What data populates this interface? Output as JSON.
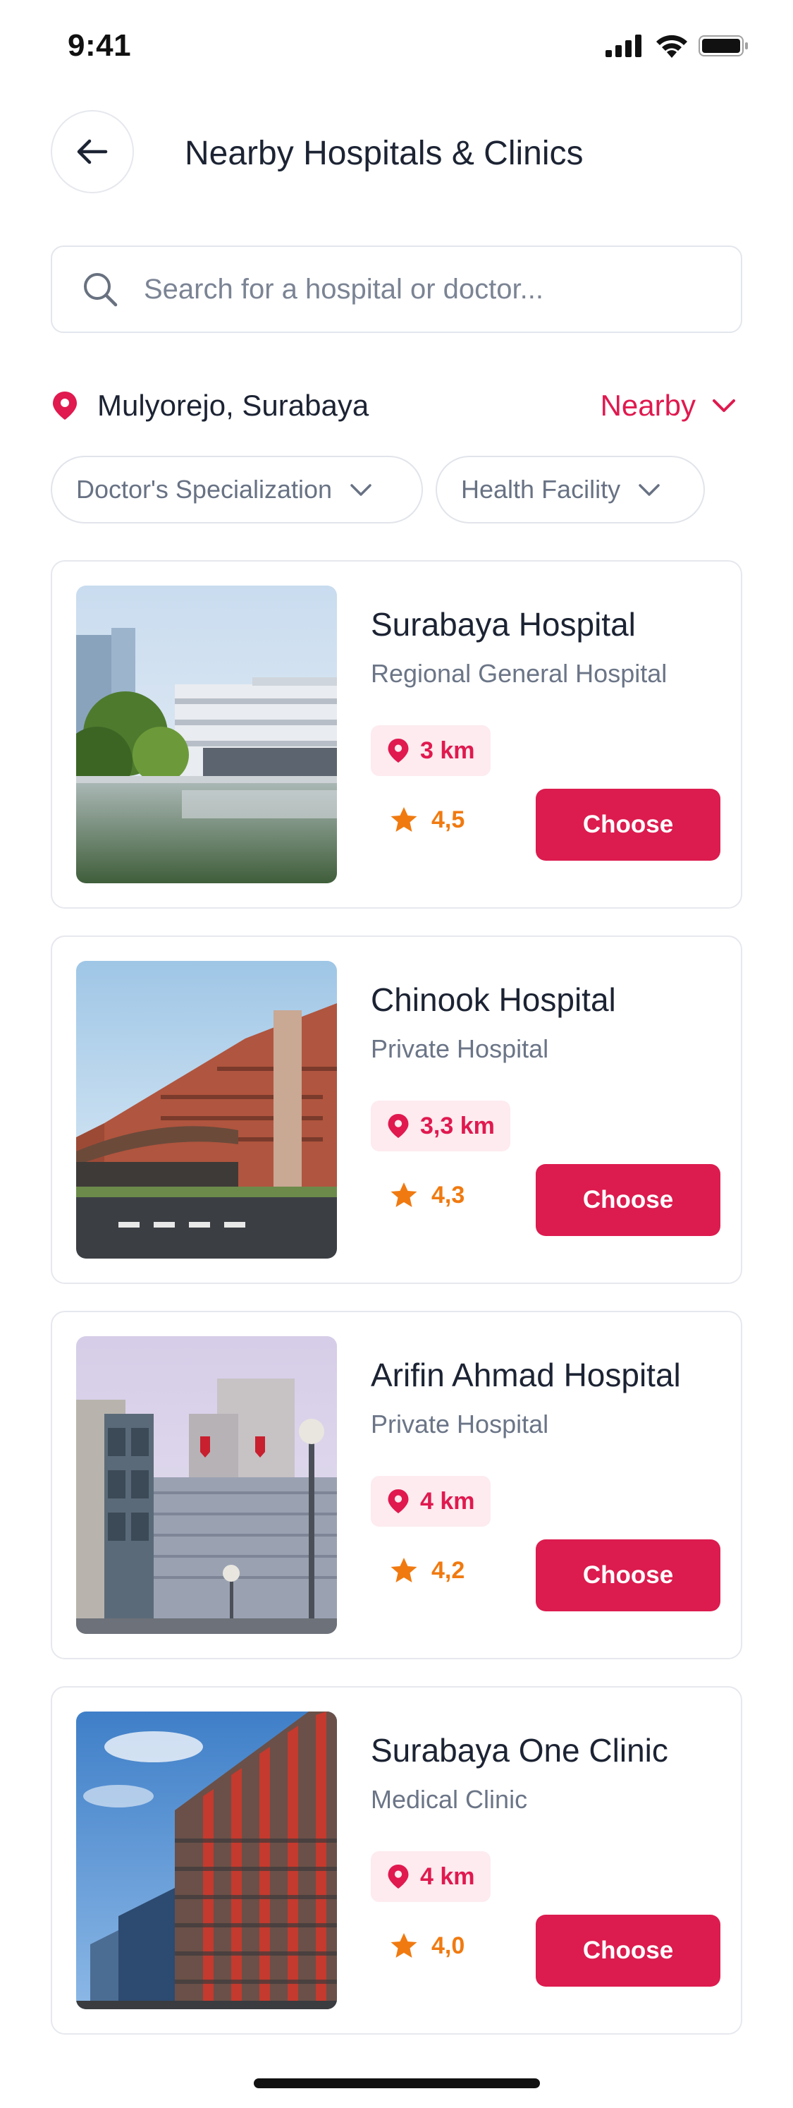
{
  "status_bar": {
    "time": "9:41"
  },
  "header": {
    "title": "Nearby Hospitals & Clinics",
    "back_icon": "arrow-left-icon"
  },
  "search": {
    "placeholder": "Search for a hospital or doctor...",
    "value": ""
  },
  "location": {
    "text": "Mulyorejo, Surabaya",
    "sort_label": "Nearby"
  },
  "filters": [
    {
      "label": "Doctor's Specialization"
    },
    {
      "label": "Health Facility"
    }
  ],
  "hospitals": [
    {
      "name": "Surabaya Hospital",
      "type": "Regional General Hospital",
      "distance": "3 km",
      "rating": "4,5",
      "action": "Choose"
    },
    {
      "name": "Chinook Hospital",
      "type": "Private Hospital",
      "distance": "3,3 km",
      "rating": "4,3",
      "action": "Choose"
    },
    {
      "name": "Arifin Ahmad Hospital",
      "type": "Private Hospital",
      "distance": "4 km",
      "rating": "4,2",
      "action": "Choose"
    },
    {
      "name": "Surabaya One Clinic",
      "type": "Medical Clinic",
      "distance": "4 km",
      "rating": "4,0",
      "action": "Choose"
    }
  ],
  "colors": {
    "accent": "#dc1b4e",
    "rating": "#f07a10",
    "badge_bg": "#fdebef"
  }
}
